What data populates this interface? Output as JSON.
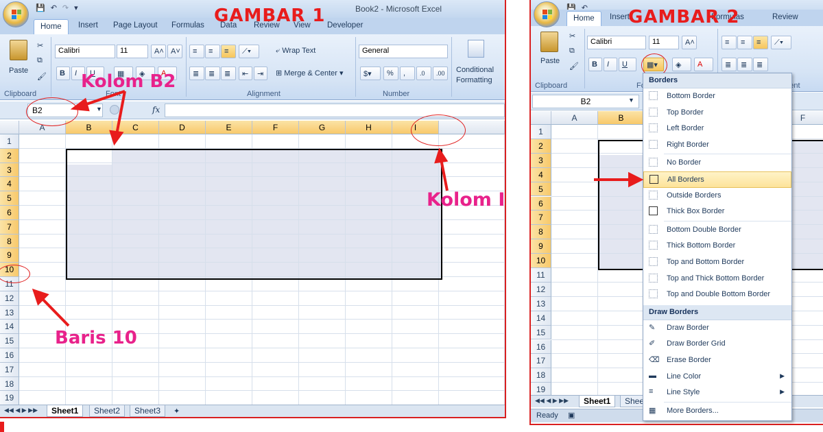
{
  "image1": {
    "window_title": "Book2 - Microsoft Excel",
    "tabs": [
      "Home",
      "Insert",
      "Page Layout",
      "Formulas",
      "Data",
      "Review",
      "View",
      "Developer"
    ],
    "ribbon": {
      "paste": "Paste",
      "clipboard": "Clipboard",
      "font_name": "Calibri",
      "font_size": "11",
      "font_group": "Font",
      "wrap_text": "Wrap Text",
      "merge_center": "Merge & Center",
      "alignment": "Alignment",
      "number_format": "General",
      "number": "Number",
      "conditional": "Conditional",
      "formatting": "Formatting"
    },
    "name_box": "B2",
    "fx": "fx",
    "columns": [
      "A",
      "B",
      "C",
      "D",
      "E",
      "F",
      "G",
      "H",
      "I"
    ],
    "rows": [
      "1",
      "2",
      "3",
      "4",
      "5",
      "6",
      "7",
      "8",
      "9",
      "10",
      "11",
      "12",
      "13",
      "14",
      "15",
      "16",
      "17",
      "18",
      "19"
    ],
    "sheets": [
      "Sheet1",
      "Sheet2",
      "Sheet3"
    ],
    "annotations": {
      "gambar": "GAMBAR 1",
      "kolom_b2": "Kolom B2",
      "kolom_i": "Kolom I",
      "baris_10": "Baris 10"
    }
  },
  "image2": {
    "tabs": [
      "Home",
      "Insert",
      "Formulas",
      "Review"
    ],
    "ribbon": {
      "paste": "Paste",
      "clipboard": "Clipboard",
      "font_name": "Calibri",
      "font_size": "11",
      "font_group_partial": "Fo",
      "alignment_partial": "nment"
    },
    "name_box": "B2",
    "columns": [
      "A",
      "B",
      "F"
    ],
    "rows": [
      "1",
      "2",
      "3",
      "4",
      "5",
      "6",
      "7",
      "8",
      "9",
      "10",
      "11",
      "12",
      "13",
      "14",
      "15",
      "16",
      "17",
      "18",
      "19"
    ],
    "sheet_tab": "Sheet1",
    "sheet_tab_partial": "Shee",
    "status": "Ready",
    "annotation": "GAMBAR 2",
    "borders_menu": {
      "header": "Borders",
      "items": [
        "Bottom Border",
        "Top Border",
        "Left Border",
        "Right Border",
        "No Border",
        "All Borders",
        "Outside Borders",
        "Thick Box Border",
        "Bottom Double Border",
        "Thick Bottom Border",
        "Top and Bottom Border",
        "Top and Thick Bottom Border",
        "Top and Double Bottom Border"
      ],
      "draw_header": "Draw Borders",
      "draw_items": [
        "Draw Border",
        "Draw Border Grid",
        "Erase Border",
        "Line Color",
        "Line Style",
        "More Borders..."
      ]
    }
  },
  "colors": {
    "annotation_red": "#e81c1c",
    "annotation_pink": "#e8228b",
    "ribbon_blue": "#bfd4ee",
    "selected_header": "#f8c96b"
  }
}
